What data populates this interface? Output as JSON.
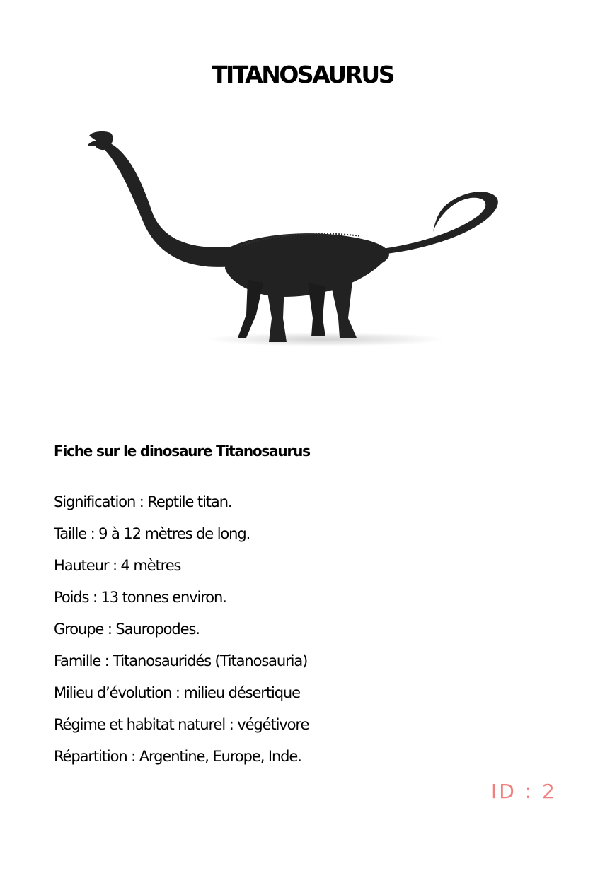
{
  "page": {
    "title": "TITANOSAURUS",
    "illustration_icon": "titanosaurus-dinosaur-silhouette",
    "heading": "Fiche sur le dinosaure Titanosaurus",
    "facts": [
      "Signification : Reptile titan.",
      "Taille : 9 à 12 mètres de long.",
      "Hauteur : 4 mètres",
      "Poids : 13 tonnes environ.",
      "Groupe : Sauropodes.",
      "Famille : Titanosauridés (Titanosauria)",
      "Milieu d’évolution : milieu désertique",
      "Régime et habitat naturel : végétivore",
      "Répartition : Argentine, Europe, Inde."
    ],
    "id_label": "ID : 2"
  },
  "colors": {
    "text": "#000000",
    "background": "#ffffff",
    "id_label": "#f07f7f",
    "dinosaur_body": "#222222"
  }
}
